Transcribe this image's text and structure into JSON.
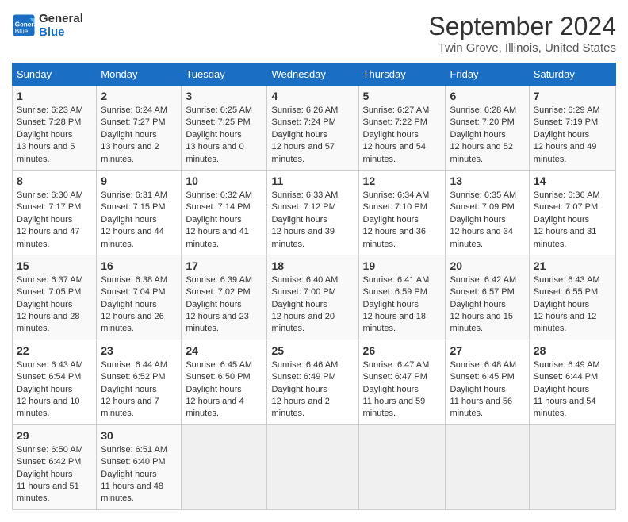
{
  "logo": {
    "line1": "General",
    "line2": "Blue"
  },
  "title": "September 2024",
  "subtitle": "Twin Grove, Illinois, United States",
  "header_colors": {
    "bg": "#1a6fc4"
  },
  "weekdays": [
    "Sunday",
    "Monday",
    "Tuesday",
    "Wednesday",
    "Thursday",
    "Friday",
    "Saturday"
  ],
  "weeks": [
    [
      {
        "day": "1",
        "sunrise": "6:23 AM",
        "sunset": "7:28 PM",
        "daylight": "13 hours and 5 minutes."
      },
      {
        "day": "2",
        "sunrise": "6:24 AM",
        "sunset": "7:27 PM",
        "daylight": "13 hours and 2 minutes."
      },
      {
        "day": "3",
        "sunrise": "6:25 AM",
        "sunset": "7:25 PM",
        "daylight": "13 hours and 0 minutes."
      },
      {
        "day": "4",
        "sunrise": "6:26 AM",
        "sunset": "7:24 PM",
        "daylight": "12 hours and 57 minutes."
      },
      {
        "day": "5",
        "sunrise": "6:27 AM",
        "sunset": "7:22 PM",
        "daylight": "12 hours and 54 minutes."
      },
      {
        "day": "6",
        "sunrise": "6:28 AM",
        "sunset": "7:20 PM",
        "daylight": "12 hours and 52 minutes."
      },
      {
        "day": "7",
        "sunrise": "6:29 AM",
        "sunset": "7:19 PM",
        "daylight": "12 hours and 49 minutes."
      }
    ],
    [
      {
        "day": "8",
        "sunrise": "6:30 AM",
        "sunset": "7:17 PM",
        "daylight": "12 hours and 47 minutes."
      },
      {
        "day": "9",
        "sunrise": "6:31 AM",
        "sunset": "7:15 PM",
        "daylight": "12 hours and 44 minutes."
      },
      {
        "day": "10",
        "sunrise": "6:32 AM",
        "sunset": "7:14 PM",
        "daylight": "12 hours and 41 minutes."
      },
      {
        "day": "11",
        "sunrise": "6:33 AM",
        "sunset": "7:12 PM",
        "daylight": "12 hours and 39 minutes."
      },
      {
        "day": "12",
        "sunrise": "6:34 AM",
        "sunset": "7:10 PM",
        "daylight": "12 hours and 36 minutes."
      },
      {
        "day": "13",
        "sunrise": "6:35 AM",
        "sunset": "7:09 PM",
        "daylight": "12 hours and 34 minutes."
      },
      {
        "day": "14",
        "sunrise": "6:36 AM",
        "sunset": "7:07 PM",
        "daylight": "12 hours and 31 minutes."
      }
    ],
    [
      {
        "day": "15",
        "sunrise": "6:37 AM",
        "sunset": "7:05 PM",
        "daylight": "12 hours and 28 minutes."
      },
      {
        "day": "16",
        "sunrise": "6:38 AM",
        "sunset": "7:04 PM",
        "daylight": "12 hours and 26 minutes."
      },
      {
        "day": "17",
        "sunrise": "6:39 AM",
        "sunset": "7:02 PM",
        "daylight": "12 hours and 23 minutes."
      },
      {
        "day": "18",
        "sunrise": "6:40 AM",
        "sunset": "7:00 PM",
        "daylight": "12 hours and 20 minutes."
      },
      {
        "day": "19",
        "sunrise": "6:41 AM",
        "sunset": "6:59 PM",
        "daylight": "12 hours and 18 minutes."
      },
      {
        "day": "20",
        "sunrise": "6:42 AM",
        "sunset": "6:57 PM",
        "daylight": "12 hours and 15 minutes."
      },
      {
        "day": "21",
        "sunrise": "6:43 AM",
        "sunset": "6:55 PM",
        "daylight": "12 hours and 12 minutes."
      }
    ],
    [
      {
        "day": "22",
        "sunrise": "6:43 AM",
        "sunset": "6:54 PM",
        "daylight": "12 hours and 10 minutes."
      },
      {
        "day": "23",
        "sunrise": "6:44 AM",
        "sunset": "6:52 PM",
        "daylight": "12 hours and 7 minutes."
      },
      {
        "day": "24",
        "sunrise": "6:45 AM",
        "sunset": "6:50 PM",
        "daylight": "12 hours and 4 minutes."
      },
      {
        "day": "25",
        "sunrise": "6:46 AM",
        "sunset": "6:49 PM",
        "daylight": "12 hours and 2 minutes."
      },
      {
        "day": "26",
        "sunrise": "6:47 AM",
        "sunset": "6:47 PM",
        "daylight": "11 hours and 59 minutes."
      },
      {
        "day": "27",
        "sunrise": "6:48 AM",
        "sunset": "6:45 PM",
        "daylight": "11 hours and 56 minutes."
      },
      {
        "day": "28",
        "sunrise": "6:49 AM",
        "sunset": "6:44 PM",
        "daylight": "11 hours and 54 minutes."
      }
    ],
    [
      {
        "day": "29",
        "sunrise": "6:50 AM",
        "sunset": "6:42 PM",
        "daylight": "11 hours and 51 minutes."
      },
      {
        "day": "30",
        "sunrise": "6:51 AM",
        "sunset": "6:40 PM",
        "daylight": "11 hours and 48 minutes."
      },
      null,
      null,
      null,
      null,
      null
    ]
  ]
}
